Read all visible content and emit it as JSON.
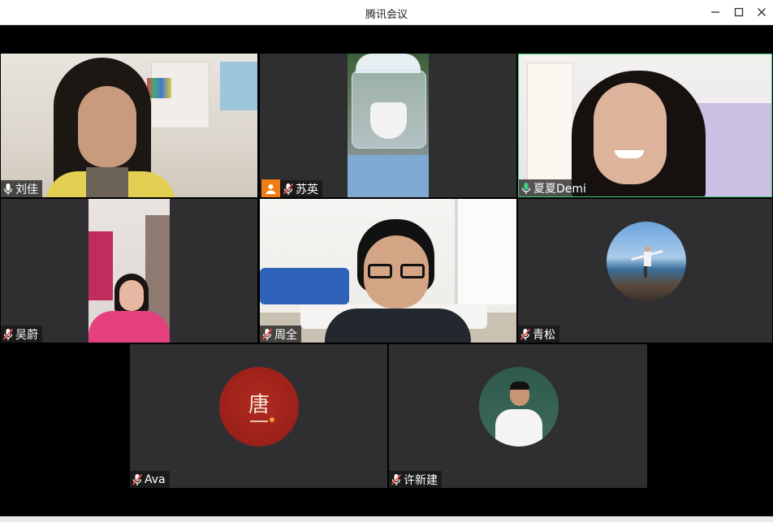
{
  "window": {
    "title": "腾讯会议"
  },
  "participants": [
    {
      "name": "刘佳"
    },
    {
      "name": "苏英"
    },
    {
      "name": "夏夏Demi"
    },
    {
      "name": "吴蔚"
    },
    {
      "name": "周全"
    },
    {
      "name": "青松"
    },
    {
      "name": "Ava"
    },
    {
      "name": "许新建"
    }
  ],
  "ava_logo": {
    "glyph": "唐"
  },
  "colors": {
    "active_speaker_border": "#3fd07b",
    "badge_orange": "#f07d14",
    "tile_bg": "#2f2f31"
  }
}
